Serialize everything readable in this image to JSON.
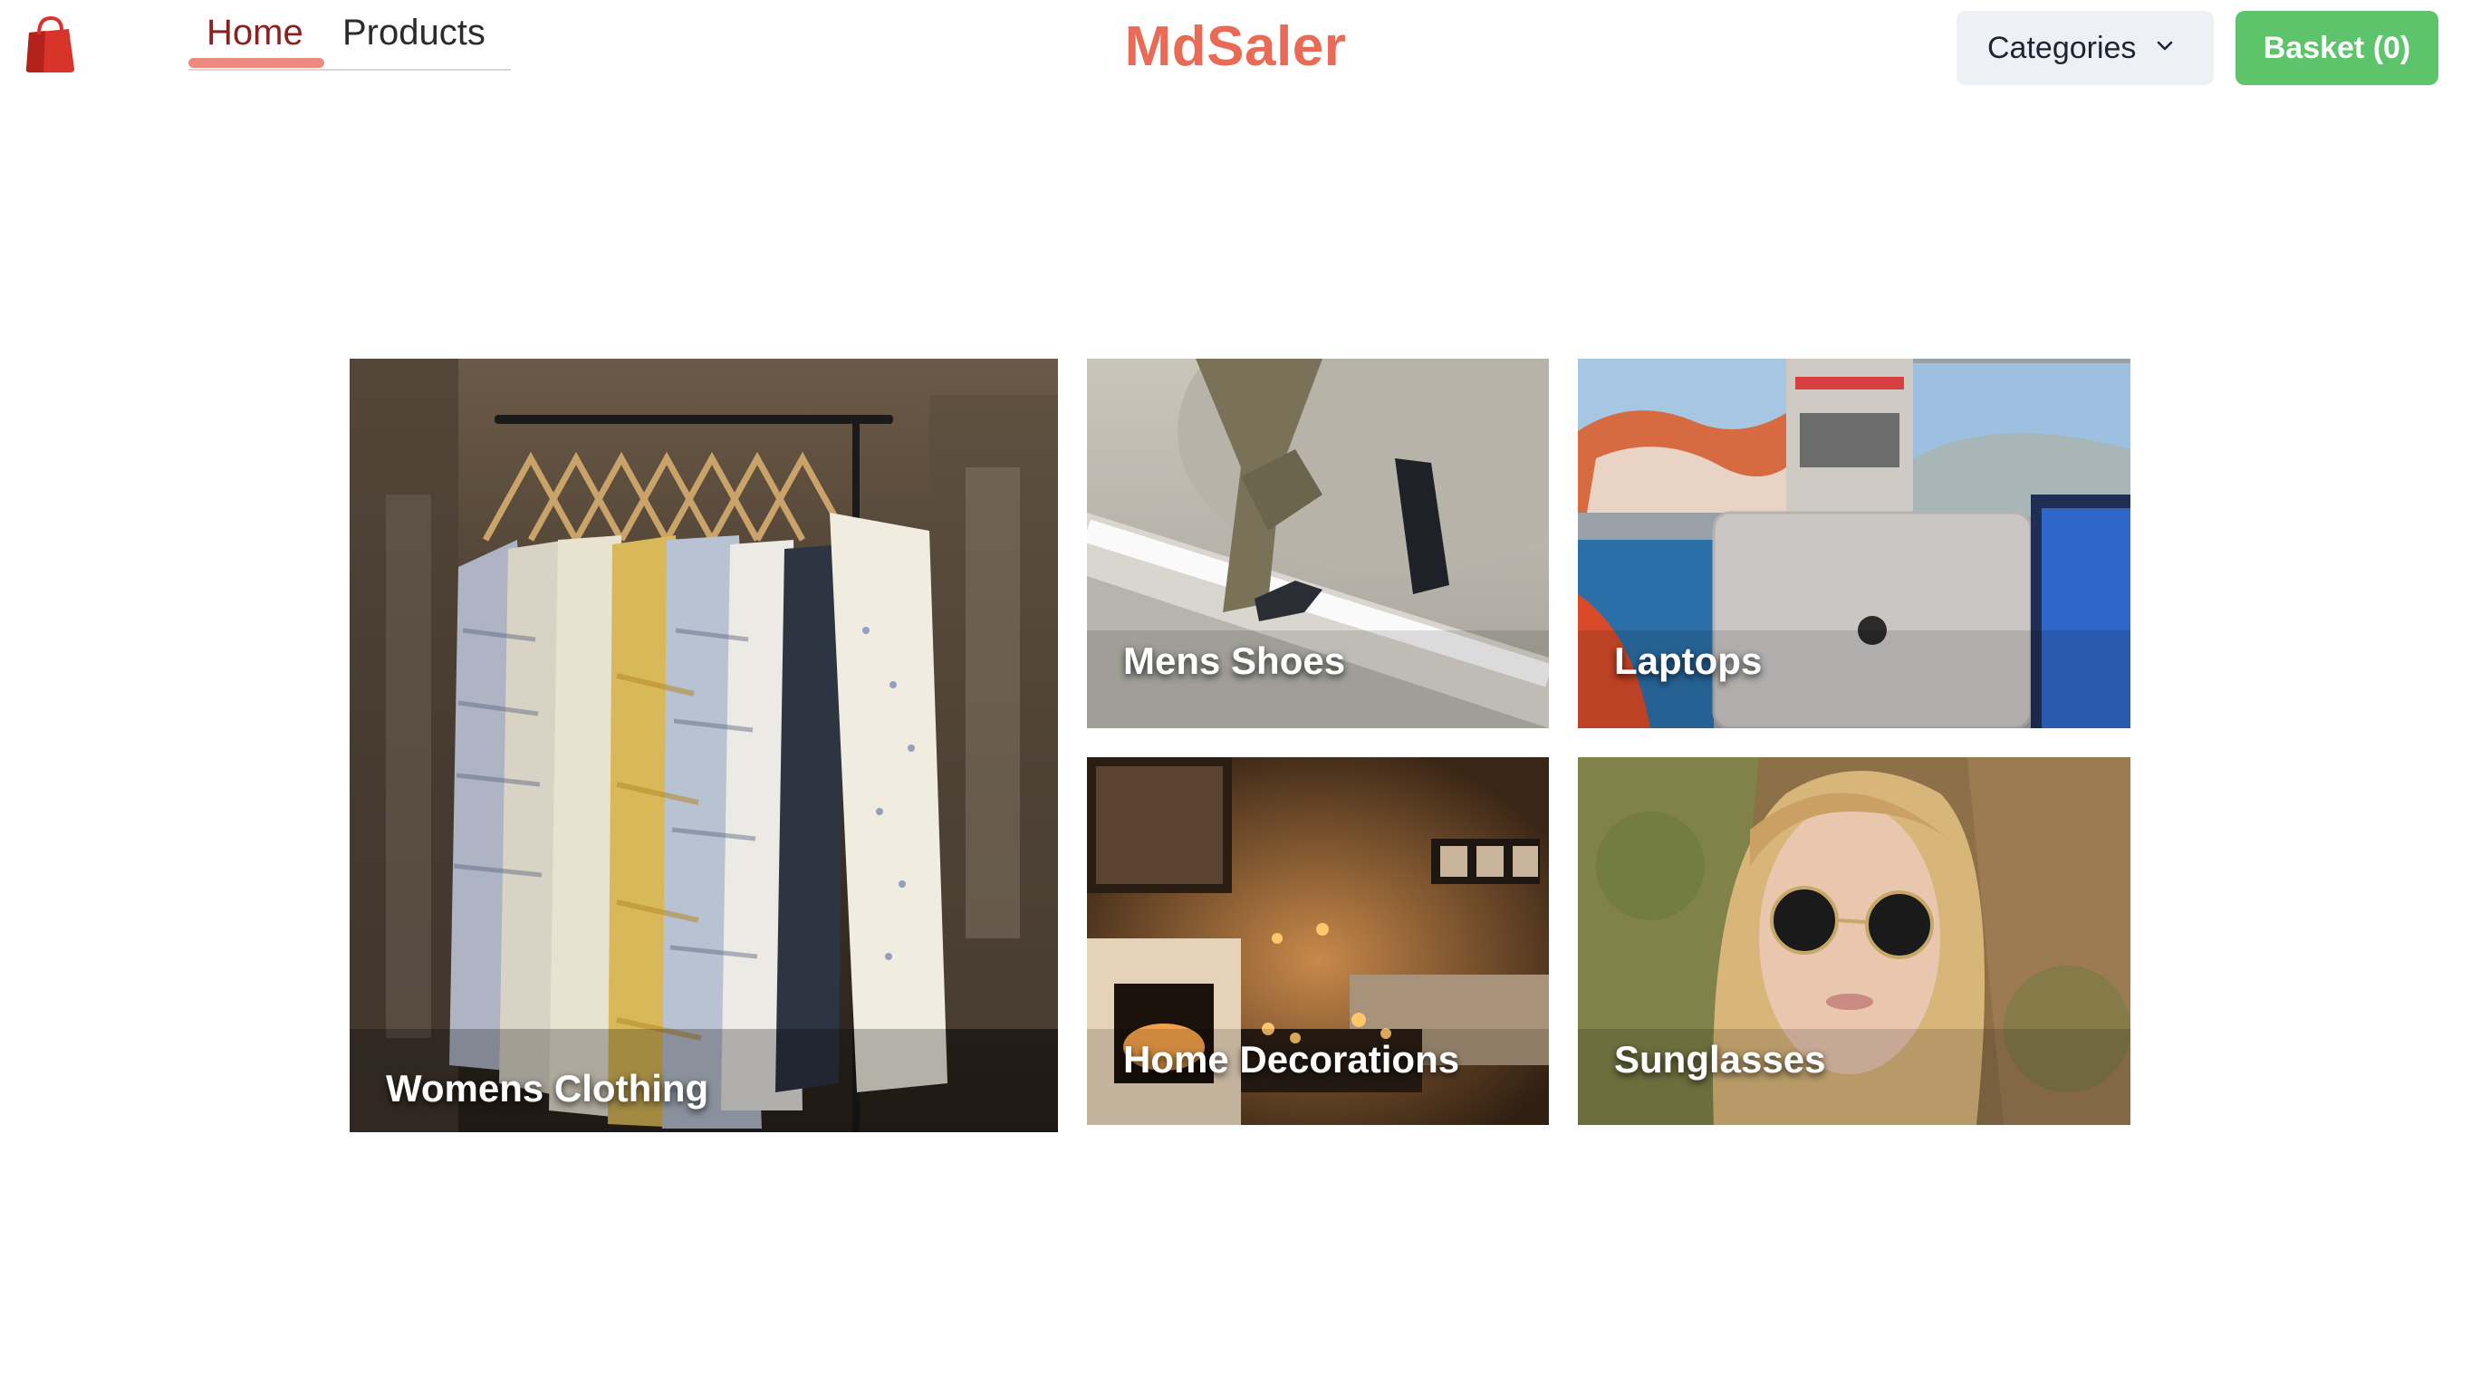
{
  "brand": {
    "name": "MdSaler",
    "color": "#e96a55"
  },
  "logo": {
    "icon": "shopping-bag-icon",
    "color": "#d8342a"
  },
  "nav": {
    "items": [
      "Home",
      "Products"
    ],
    "active": "Home"
  },
  "categories_button": {
    "label": "Categories",
    "icon": "chevron-down-icon"
  },
  "basket_button": {
    "label": "Basket (0)",
    "color": "#5dc46b"
  },
  "tiles": [
    {
      "label": "Womens Clothing"
    },
    {
      "label": "Mens Shoes"
    },
    {
      "label": "Laptops"
    },
    {
      "label": "Home Decorations"
    },
    {
      "label": "Sunglasses"
    }
  ]
}
